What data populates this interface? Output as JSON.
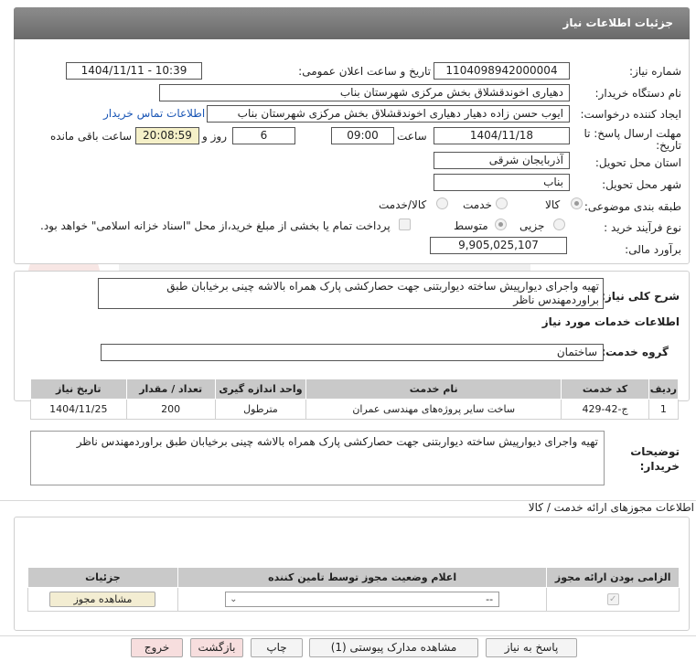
{
  "header": {
    "title": "جزئیات اطلاعات نیاز"
  },
  "form": {
    "need_number_label": "شماره نیاز:",
    "need_number": "1104098942000004",
    "announce_label": "تاریخ و ساعت اعلان عمومی:",
    "announce_value": "1404/11/11 - 10:39",
    "buyer_org_label": "نام دستگاه خریدار:",
    "buyer_org": "دهیاری اخوندقشلاق بخش مرکزی شهرستان بناب",
    "requester_label": "ایجاد کننده درخواست:",
    "requester": "ایوب حسن زاده دهیار دهیاری اخوندقشلاق بخش مرکزی شهرستان بناب",
    "contact_link": "اطلاعات تماس خریدار",
    "deadline_label_1": "مهلت ارسال پاسخ: تا",
    "deadline_label_2": "تاریخ:",
    "deadline_date": "1404/11/18",
    "time_label": "ساعت",
    "deadline_time": "09:00",
    "days_value": "6",
    "days_label": "روز و",
    "remaining_time": "20:08:59",
    "remaining_label": "ساعت باقی مانده",
    "province_label": "استان محل تحویل:",
    "province": "آذربایجان شرقی",
    "city_label": "شهر محل تحویل:",
    "city": "بناب",
    "category_label": "طبقه بندی موضوعی:",
    "category_options": [
      "کالا",
      "خدمت",
      "کالا/خدمت"
    ],
    "process_label": "نوع فرآیند خرید :",
    "process_options": [
      "جزیی",
      "متوسط"
    ],
    "payment_note": "پرداخت تمام یا بخشی از مبلغ خرید،از محل \"اسناد خزانه اسلامی\" خواهد بود.",
    "estimate_label": "برآورد مالی:",
    "estimate": "9,905,025,107"
  },
  "description": {
    "label": "شرح کلی نیاز:",
    "text": "تهیه واجرای دیوارپیش ساخته دیواربتنی جهت حصارکشی پارک همراه بالاشه چینی برخیابان طبق براوردمهندس ناظر"
  },
  "services": {
    "title": "اطلاعات خدمات مورد نیاز",
    "group_label": "گروه خدمت:",
    "group_value": "ساختمان",
    "table": {
      "headers": [
        "ردیف",
        "کد خدمت",
        "نام خدمت",
        "واحد اندازه گیری",
        "تعداد / مقدار",
        "تاریخ نیاز"
      ],
      "rows": [
        [
          "1",
          "ج-42-429",
          "ساخت سایر پروژه‌های مهندسی عمران",
          "مترطول",
          "200",
          "1404/11/25"
        ]
      ]
    },
    "buyer_notes_label_1": "توضیحات",
    "buyer_notes_label_2": "خریدار:",
    "buyer_notes": "تهیه واجرای دیوارپیش ساخته دیواربتنی جهت حصارکشی پارک همراه بالاشه چینی برخیابان طبق براوردمهندس ناظر"
  },
  "permits": {
    "title": "اطلاعات مجوزهای ارائه خدمت / کالا",
    "headers": [
      "الزامی بودن ارائه مجوز",
      "اعلام وضعیت مجوز توسط تامین کننده",
      "جزئیات"
    ],
    "select_value": "--",
    "view_button": "مشاهده مجوز"
  },
  "buttons": {
    "reply": "پاسخ به نیاز",
    "attachments": "مشاهده مدارک پیوستی (1)",
    "print": "چاپ",
    "back": "بازگشت",
    "exit": "خروج"
  },
  "colors": {
    "header": "#7a7a7a",
    "link": "#1a56b5",
    "highlight": "#f5f0c8",
    "table_header": "#c9c9c9"
  }
}
